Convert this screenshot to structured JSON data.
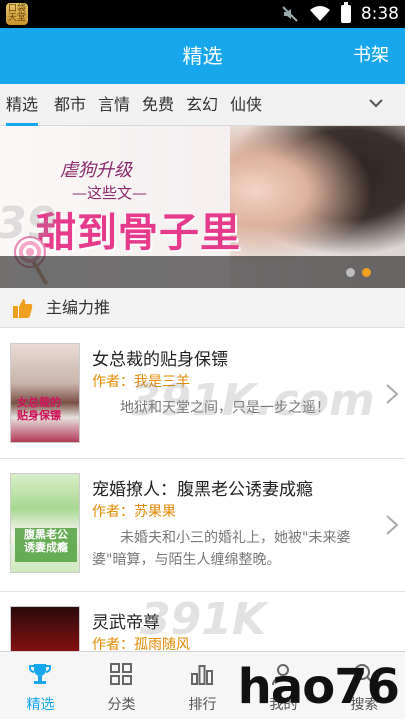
{
  "status_bar": {
    "app_icon_text": "口袋天堂",
    "time": "8:38"
  },
  "app_bar": {
    "title": "精选",
    "bookshelf_label": "书架"
  },
  "tabs": [
    {
      "label": "精选",
      "active": true
    },
    {
      "label": "都市"
    },
    {
      "label": "言情"
    },
    {
      "label": "免费"
    },
    {
      "label": "玄幻"
    },
    {
      "label": "仙侠"
    }
  ],
  "banner": {
    "tag": "虐狗升级",
    "sub": "—这些文—",
    "headline": "甜到骨子里",
    "page_count": 2,
    "active_page": 2
  },
  "section": {
    "title": "主编力推"
  },
  "books": [
    {
      "title": "女总裁的贴身保镖",
      "author_prefix": "作者：",
      "author": "我是三羊",
      "description": "地狱和天堂之间，只是一步之遥！"
    },
    {
      "title": "宠婚撩人：腹黑老公诱妻成瘾",
      "author_prefix": "作者：",
      "author": "苏果果",
      "description": "未婚夫和小三的婚礼上，她被\"未来婆婆\"暗算，与陌生人缠绵整晚。"
    },
    {
      "title": "灵武帝尊",
      "author_prefix": "作者：",
      "author": "孤雨随风",
      "description": ""
    }
  ],
  "bottom_nav": [
    {
      "label": "精选",
      "icon": "trophy-icon",
      "active": true
    },
    {
      "label": "分类",
      "icon": "grid-icon"
    },
    {
      "label": "排行",
      "icon": "bar-chart-icon"
    },
    {
      "label": "我的",
      "icon": "user-icon"
    },
    {
      "label": "搜索",
      "icon": "search-icon"
    }
  ],
  "watermarks": {
    "site": "391K.com",
    "brand": "hao76"
  },
  "colors": {
    "primary": "#18a7ec",
    "author": "#e08a00",
    "banner_headline": "#e63a8c",
    "active_dot": "#f0a020"
  }
}
